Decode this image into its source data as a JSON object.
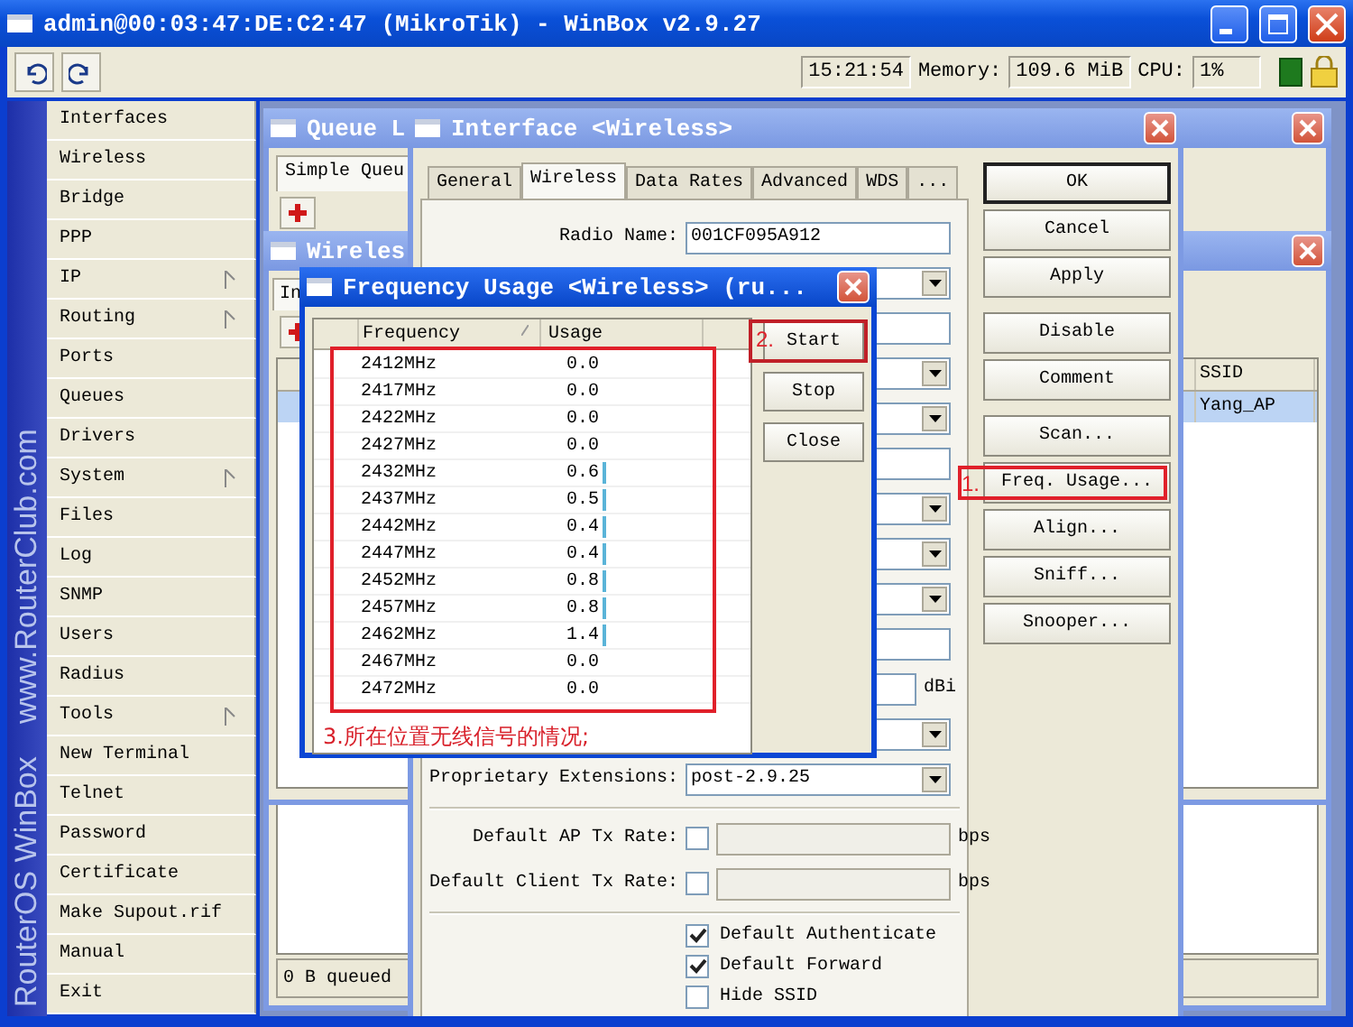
{
  "window": {
    "title": "admin@00:03:47:DE:C2:47 (MikroTik) - WinBox v2.9.27"
  },
  "toolbar": {
    "time": "15:21:54",
    "memory_label": "Memory:",
    "memory": "109.6 MiB",
    "cpu_label": "CPU:",
    "cpu": "1%"
  },
  "sidebar": {
    "brand": "RouterOS WinBox",
    "site": "www.RouterClub.com",
    "items": [
      {
        "label": "Interfaces",
        "has_submenu": false
      },
      {
        "label": "Wireless",
        "has_submenu": false
      },
      {
        "label": "Bridge",
        "has_submenu": false
      },
      {
        "label": "PPP",
        "has_submenu": false
      },
      {
        "label": "IP",
        "has_submenu": true
      },
      {
        "label": "Routing",
        "has_submenu": true
      },
      {
        "label": "Ports",
        "has_submenu": false
      },
      {
        "label": "Queues",
        "has_submenu": false
      },
      {
        "label": "Drivers",
        "has_submenu": false
      },
      {
        "label": "System",
        "has_submenu": true
      },
      {
        "label": "Files",
        "has_submenu": false
      },
      {
        "label": "Log",
        "has_submenu": false
      },
      {
        "label": "SNMP",
        "has_submenu": false
      },
      {
        "label": "Users",
        "has_submenu": false
      },
      {
        "label": "Radius",
        "has_submenu": false
      },
      {
        "label": "Tools",
        "has_submenu": true
      },
      {
        "label": "New Terminal",
        "has_submenu": false
      },
      {
        "label": "Telnet",
        "has_submenu": false
      },
      {
        "label": "Password",
        "has_submenu": false
      },
      {
        "label": "Certificate",
        "has_submenu": false
      },
      {
        "label": "Make Supout.rif",
        "has_submenu": false
      },
      {
        "label": "Manual",
        "has_submenu": false
      },
      {
        "label": "Exit",
        "has_submenu": false
      }
    ]
  },
  "queue_window": {
    "title": "Queue L",
    "tabs": [
      {
        "label": "Simple Queu",
        "selected": true
      }
    ],
    "status": "0 B queued"
  },
  "wireless_window": {
    "title": "Wireles",
    "tabs": [
      {
        "label": "In",
        "selected": true
      }
    ],
    "table": {
      "columns": [
        "SSID"
      ],
      "rows": [
        {
          "cells": [
            "Yang_AP"
          ],
          "selected": true
        }
      ]
    }
  },
  "interface_window": {
    "title": "Interface <Wireless>",
    "tabs": [
      {
        "label": "General",
        "selected": false
      },
      {
        "label": "Wireless",
        "selected": true
      },
      {
        "label": "Data Rates",
        "selected": false
      },
      {
        "label": "Advanced",
        "selected": false
      },
      {
        "label": "WDS",
        "selected": false
      },
      {
        "label": "...",
        "selected": false
      }
    ],
    "fields": [
      {
        "kind": "field",
        "label": "Radio Name:",
        "value": "001CF095A912"
      },
      {
        "kind": "dropdown"
      },
      {
        "kind": "field"
      },
      {
        "kind": "dropdown"
      },
      {
        "kind": "dropdown"
      },
      {
        "kind": "field"
      },
      {
        "kind": "dropdown"
      },
      {
        "kind": "dropdown"
      },
      {
        "kind": "dropdown"
      },
      {
        "kind": "field"
      },
      {
        "kind": "field",
        "unit": "dBi"
      },
      {
        "kind": "dropdown"
      },
      {
        "kind": "dropdown",
        "label": "Proprietary Extensions:",
        "value": "post-2.9.25"
      }
    ],
    "rate_fields": [
      {
        "label": "Default AP Tx Rate:",
        "checked": false,
        "unit": "bps"
      },
      {
        "label": "Default Client Tx Rate:",
        "checked": false,
        "unit": "bps"
      }
    ],
    "checkboxes": [
      {
        "label": "Default Authenticate",
        "checked": true
      },
      {
        "label": "Default Forward",
        "checked": true
      },
      {
        "label": "Hide SSID",
        "checked": false
      }
    ],
    "button_groups": [
      [
        {
          "label": "OK",
          "default": true
        },
        {
          "label": "Cancel",
          "default": false
        },
        {
          "label": "Apply",
          "default": false
        }
      ],
      [
        {
          "label": "Disable",
          "default": false
        },
        {
          "label": "Comment",
          "default": false
        }
      ],
      [
        {
          "label": "Scan...",
          "default": false
        },
        {
          "label": "Freq. Usage...",
          "default": false,
          "annotation": "1."
        },
        {
          "label": "Align...",
          "default": false
        },
        {
          "label": "Sniff...",
          "default": false
        },
        {
          "label": "Snooper...",
          "default": false
        }
      ]
    ]
  },
  "frequency_usage": {
    "title": "Frequency Usage <Wireless> (ru...",
    "columns": [
      {
        "label": "Frequency",
        "sorted": true
      },
      {
        "label": "Usage",
        "sorted": false
      }
    ],
    "rows": [
      {
        "frequency": "2412MHz",
        "usage": "0.0",
        "usage_bar": false
      },
      {
        "frequency": "2417MHz",
        "usage": "0.0",
        "usage_bar": false
      },
      {
        "frequency": "2422MHz",
        "usage": "0.0",
        "usage_bar": false
      },
      {
        "frequency": "2427MHz",
        "usage": "0.0",
        "usage_bar": false
      },
      {
        "frequency": "2432MHz",
        "usage": "0.6",
        "usage_bar": true
      },
      {
        "frequency": "2437MHz",
        "usage": "0.5",
        "usage_bar": true
      },
      {
        "frequency": "2442MHz",
        "usage": "0.4",
        "usage_bar": true
      },
      {
        "frequency": "2447MHz",
        "usage": "0.4",
        "usage_bar": true
      },
      {
        "frequency": "2452MHz",
        "usage": "0.8",
        "usage_bar": true
      },
      {
        "frequency": "2457MHz",
        "usage": "0.8",
        "usage_bar": true
      },
      {
        "frequency": "2462MHz",
        "usage": "1.4",
        "usage_bar": true
      },
      {
        "frequency": "2467MHz",
        "usage": "0.0",
        "usage_bar": false
      },
      {
        "frequency": "2472MHz",
        "usage": "0.0",
        "usage_bar": false
      }
    ],
    "callout": "3.所在位置无线信号的情况;",
    "buttons": [
      {
        "label": "Start",
        "annotation": "2."
      },
      {
        "label": "Stop"
      },
      {
        "label": "Close"
      }
    ]
  }
}
